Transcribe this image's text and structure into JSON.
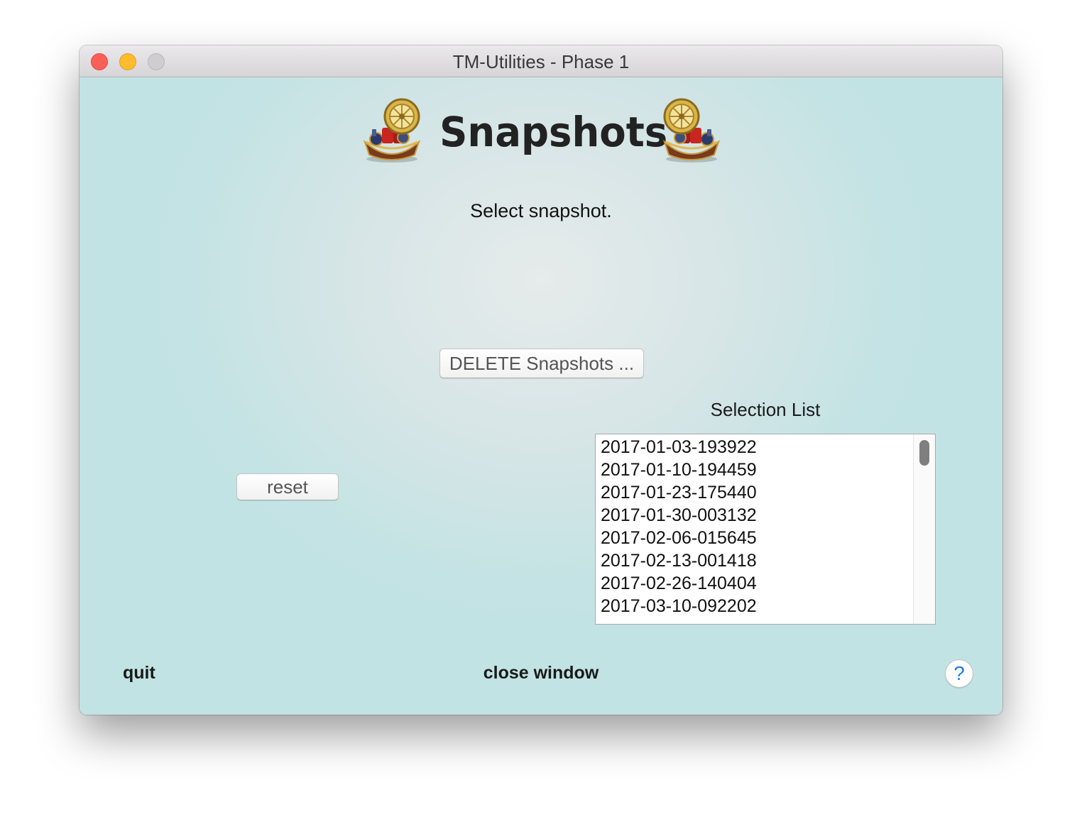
{
  "window": {
    "title": "TM-Utilities - Phase 1"
  },
  "header": {
    "title": "Snapshots",
    "icon": "treasure-chest-icon"
  },
  "instruction": "Select snapshot.",
  "buttons": {
    "delete_label": "DELETE Snapshots ...",
    "reset_label": "reset",
    "quit_label": "quit",
    "close_window_label": "close window",
    "help_label": "?"
  },
  "selection_list": {
    "label": "Selection List",
    "items": [
      "2017-01-03-193922",
      "2017-01-10-194459",
      "2017-01-23-175440",
      "2017-01-30-003132",
      "2017-02-06-015645",
      "2017-02-13-001418",
      "2017-02-26-140404",
      "2017-03-10-092202"
    ]
  },
  "colors": {
    "window_background": "#c3e3e4",
    "close_light": "#fc5f57",
    "minimize_light": "#fdbc2e",
    "zoom_light": "#cfcdcf",
    "help_accent": "#1b7cf2"
  }
}
